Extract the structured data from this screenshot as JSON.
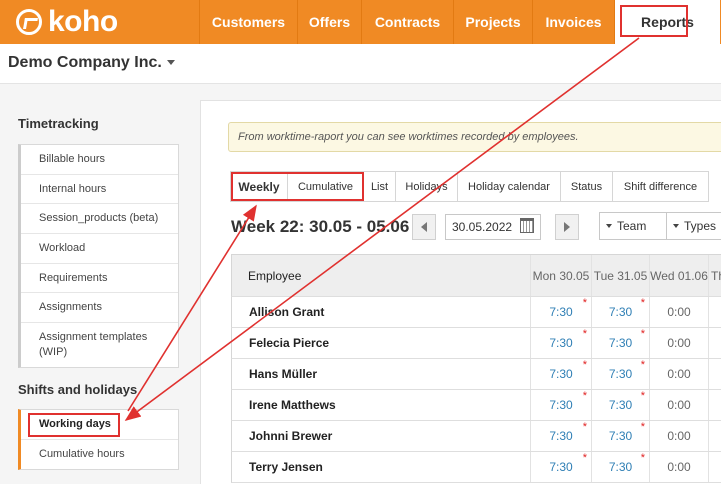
{
  "app": {
    "logo_text": "koho",
    "brand_color": "#f08a24",
    "annotation_color": "#e0312f"
  },
  "nav": {
    "items": [
      {
        "label": "Customers"
      },
      {
        "label": "Offers"
      },
      {
        "label": "Contracts"
      },
      {
        "label": "Projects"
      },
      {
        "label": "Invoices"
      },
      {
        "label": "Reports",
        "active": true
      }
    ]
  },
  "company": {
    "name": "Demo Company Inc."
  },
  "sidebar": {
    "timetracking": {
      "title": "Timetracking",
      "items": [
        {
          "label": "Billable hours"
        },
        {
          "label": "Internal hours"
        },
        {
          "label": "Session_products (beta)"
        },
        {
          "label": "Workload"
        },
        {
          "label": "Requirements"
        },
        {
          "label": "Assignments"
        },
        {
          "label": "Assignment templates (WIP)"
        }
      ]
    },
    "shifts": {
      "title": "Shifts and holidays",
      "items": [
        {
          "label": "Working days",
          "active": true
        },
        {
          "label": "Cumulative hours"
        }
      ]
    }
  },
  "main": {
    "info_text": "From worktime-raport you can see worktimes recorded by employees.",
    "tabs": [
      {
        "label": "Weekly",
        "active": true
      },
      {
        "label": "Cumulative"
      },
      {
        "label": "List"
      },
      {
        "label": "Holidays"
      },
      {
        "label": "Holiday calendar"
      },
      {
        "label": "Status"
      },
      {
        "label": "Shift difference"
      }
    ],
    "week_title": "Week 22: 30.05 - 05.06",
    "date_value": "30.05.2022",
    "team_select": "Team",
    "types_select": "Types"
  },
  "table": {
    "headers": [
      "Employee",
      "Mon 30.05",
      "Tue 31.05",
      "Wed 01.06",
      "Th"
    ],
    "rows": [
      {
        "name": "Allison Grant",
        "mon": "7:30",
        "tue": "7:30",
        "wed": "0:00"
      },
      {
        "name": "Felecia Pierce",
        "mon": "7:30",
        "tue": "7:30",
        "wed": "0:00"
      },
      {
        "name": "Hans Müller",
        "mon": "7:30",
        "tue": "7:30",
        "wed": "0:00"
      },
      {
        "name": "Irene Matthews",
        "mon": "7:30",
        "tue": "7:30",
        "wed": "0:00"
      },
      {
        "name": "Johnni Brewer",
        "mon": "7:30",
        "tue": "7:30",
        "wed": "0:00"
      },
      {
        "name": "Terry Jensen",
        "mon": "7:30",
        "tue": "7:30",
        "wed": "0:00"
      }
    ],
    "star_mark": "*"
  }
}
